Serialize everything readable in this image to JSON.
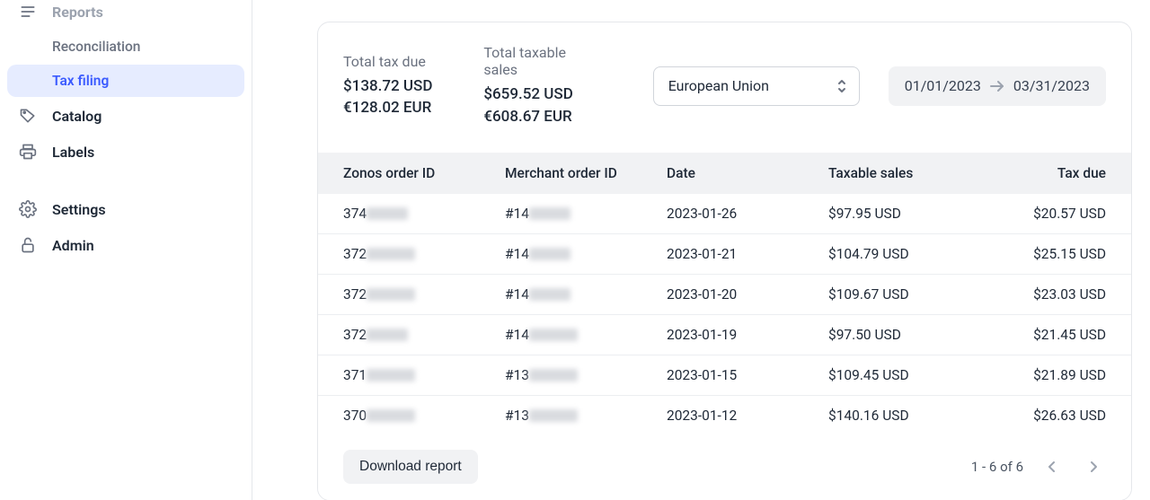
{
  "sidebar": {
    "reports": {
      "label": "Reports",
      "children": {
        "reconciliation": "Reconciliation",
        "tax_filing": "Tax filing"
      }
    },
    "catalog": "Catalog",
    "labels": "Labels",
    "settings": "Settings",
    "admin": "Admin"
  },
  "summary": {
    "total_tax_due_label": "Total tax due",
    "total_tax_due_usd": "$138.72 USD",
    "total_tax_due_eur": "€128.02 EUR",
    "total_taxable_sales_label": "Total taxable sales",
    "total_taxable_sales_usd": "$659.52 USD",
    "total_taxable_sales_eur": "€608.67 EUR"
  },
  "filters": {
    "region": "European Union",
    "date_start": "01/01/2023",
    "date_end": "03/31/2023"
  },
  "table": {
    "headers": {
      "zonos_order_id": "Zonos order ID",
      "merchant_order_id": "Merchant order ID",
      "date": "Date",
      "taxable_sales": "Taxable sales",
      "tax_due": "Tax due"
    },
    "rows": [
      {
        "zonos_prefix": "374",
        "merchant_prefix": "#14",
        "date": "2023-01-26",
        "taxable": "$97.95 USD",
        "tax_due": "$20.57 USD"
      },
      {
        "zonos_prefix": "372",
        "merchant_prefix": "#14",
        "date": "2023-01-21",
        "taxable": "$104.79 USD",
        "tax_due": "$25.15 USD"
      },
      {
        "zonos_prefix": "372",
        "merchant_prefix": "#14",
        "date": "2023-01-20",
        "taxable": "$109.67 USD",
        "tax_due": "$23.03 USD"
      },
      {
        "zonos_prefix": "372",
        "merchant_prefix": "#14",
        "date": "2023-01-19",
        "taxable": "$97.50 USD",
        "tax_due": "$21.45 USD"
      },
      {
        "zonos_prefix": "371",
        "merchant_prefix": "#13",
        "date": "2023-01-15",
        "taxable": "$109.45 USD",
        "tax_due": "$21.89 USD"
      },
      {
        "zonos_prefix": "370",
        "merchant_prefix": "#13",
        "date": "2023-01-12",
        "taxable": "$140.16 USD",
        "tax_due": "$26.63 USD"
      }
    ]
  },
  "footer": {
    "download_label": "Download report",
    "pager_text": "1 - 6 of 6"
  }
}
